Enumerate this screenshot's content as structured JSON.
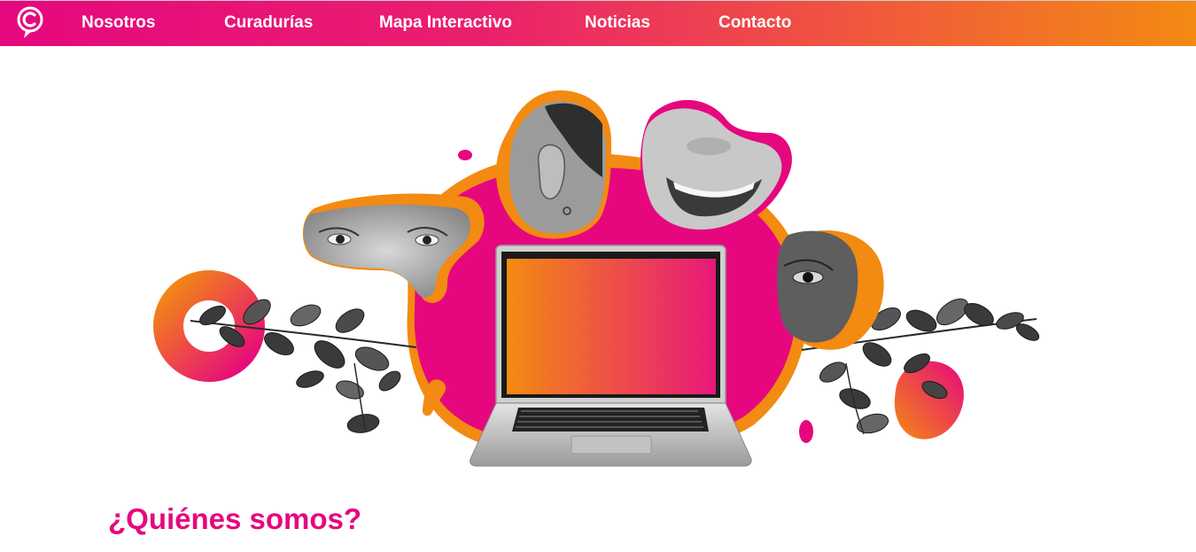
{
  "nav": {
    "items": [
      {
        "label": "Nosotros"
      },
      {
        "label": "Curadurías"
      },
      {
        "label": "Mapa Interactivo"
      },
      {
        "label": "Noticias"
      },
      {
        "label": "Contacto"
      }
    ]
  },
  "about": {
    "title": "¿Quiénes somos?"
  },
  "colors": {
    "magenta": "#e6077f",
    "orange": "#f38a12",
    "white": "#ffffff"
  },
  "icons": {
    "logo": "c-speech-bubble-logo-icon"
  },
  "hero_image": {
    "subjects": [
      "laptop",
      "eyes",
      "ear",
      "smile",
      "eye",
      "leaves",
      "ring",
      "blobs"
    ]
  }
}
